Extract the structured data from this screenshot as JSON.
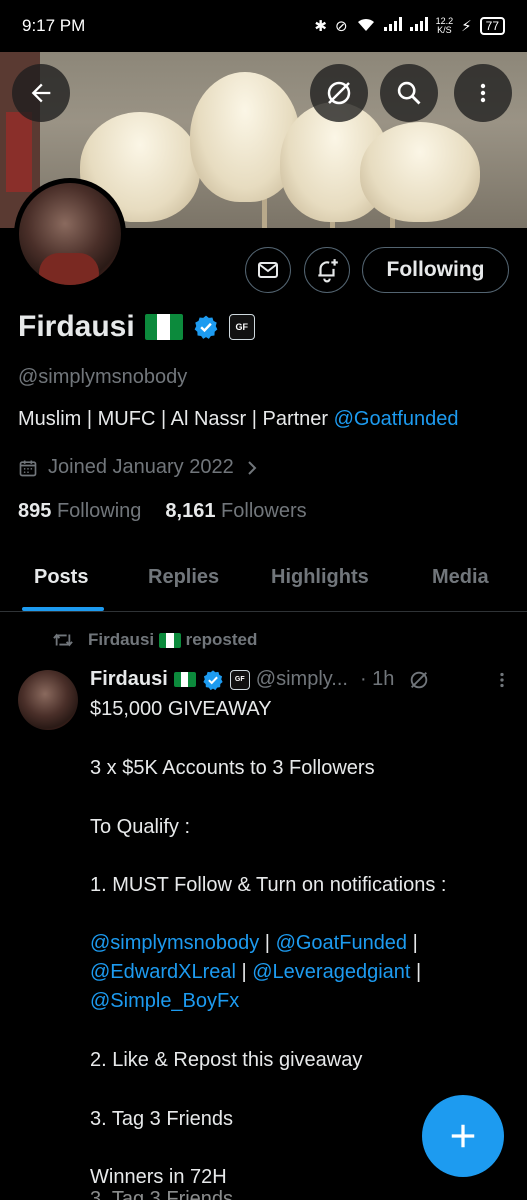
{
  "status_bar": {
    "time": "9:17 PM",
    "net_speed_value": "12.2",
    "net_speed_unit": "K/S",
    "battery": "77"
  },
  "profile": {
    "name": "Firdausi",
    "handle": "@simplymsnobody",
    "bio_text": "Muslim | MUFC | Al Nassr |  Partner ",
    "bio_link": "@Goatfunded",
    "joined": "Joined January 2022",
    "following_count": "895",
    "following_label": "Following",
    "followers_count": "8,161",
    "followers_label": "Followers",
    "follow_button": "Following",
    "affiliate_badge_text": "GF"
  },
  "tabs": [
    "Posts",
    "Replies",
    "Highlights",
    "Media"
  ],
  "post": {
    "repost_name": "Firdausi",
    "repost_label": "reposted",
    "author": "Firdausi",
    "handle": "@simply...",
    "time": "· 1h",
    "lines": {
      "l1": "$15,000 GIVEAWAY",
      "l2": "3 x $5K Accounts to 3 Followers",
      "l3": "To Qualify :",
      "l4": "1. MUST Follow & Turn on notifications :",
      "l5a": "@simplymsnobody",
      "l5b": " | ",
      "l5c": "@GoatFunded",
      "l5d": " |",
      "l6a": "@EdwardXLreal",
      "l6b": " | ",
      "l6c": "@Leveragedgiant",
      "l6d": " |",
      "l7": "@Simple_BoyFx",
      "l8": "2. Like & Repost this giveaway",
      "l9": "3. Tag 3 Friends",
      "l10": "Winners in 72H",
      "ghost": "3. Tag 3 Friends"
    }
  },
  "colors": {
    "accent": "#1d9bf0",
    "text": "#e7e9ea",
    "muted": "#71767b",
    "border": "#2f3336",
    "background": "#000000"
  },
  "icons": [
    "back-arrow-icon",
    "grok-icon",
    "search-icon",
    "more-vertical-icon",
    "mail-icon",
    "bell-plus-icon",
    "verified-icon",
    "calendar-icon",
    "chevron-right-icon",
    "repost-icon",
    "plus-icon"
  ]
}
